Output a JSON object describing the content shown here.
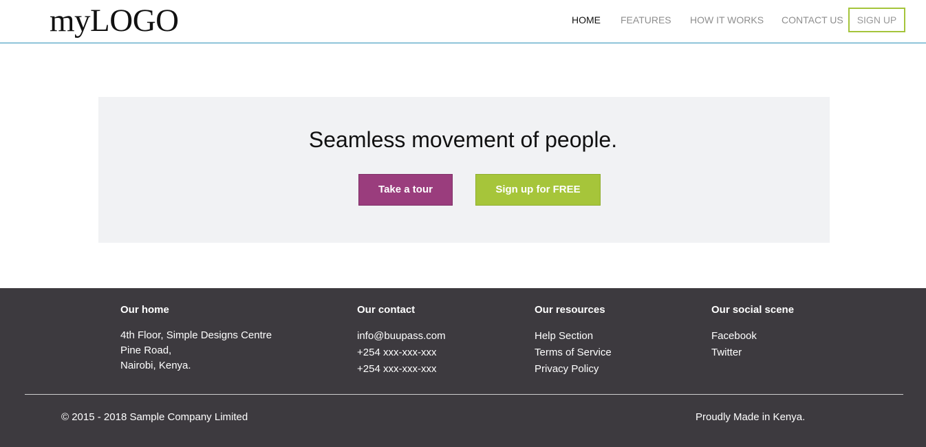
{
  "header": {
    "logo": "myLOGO",
    "nav": {
      "home": "HOME",
      "features": "FEATURES",
      "how_it_works": "HOW IT WORKS",
      "contact": "CONTACT US",
      "signup": "SIGN UP"
    }
  },
  "hero": {
    "title": "Seamless movement of people.",
    "tour_button": "Take a tour",
    "signup_button": "Sign up for FREE"
  },
  "footer": {
    "home": {
      "heading": "Our home",
      "lines": [
        "4th Floor, Simple Designs Centre",
        "Pine Road,",
        "Nairobi, Kenya."
      ]
    },
    "contact": {
      "heading": "Our contact",
      "lines": [
        "info@buupass.com",
        "+254 xxx-xxx-xxx",
        "+254 xxx-xxx-xxx"
      ]
    },
    "resources": {
      "heading": "Our resources",
      "links": [
        "Help Section",
        "Terms of Service",
        "Privacy Policy"
      ]
    },
    "social": {
      "heading": "Our social scene",
      "links": [
        "Facebook",
        "Twitter"
      ]
    },
    "copyright": "© 2015 - 2018 Sample Company Limited",
    "made_in": "Proudly Made in Kenya."
  },
  "colors": {
    "accent_purple": "#9a3d7d",
    "accent_green": "#a6c53a",
    "header_border": "#2a8fb8",
    "footer_bg": "#3d3a3f",
    "hero_bg": "#f1f2f4"
  }
}
